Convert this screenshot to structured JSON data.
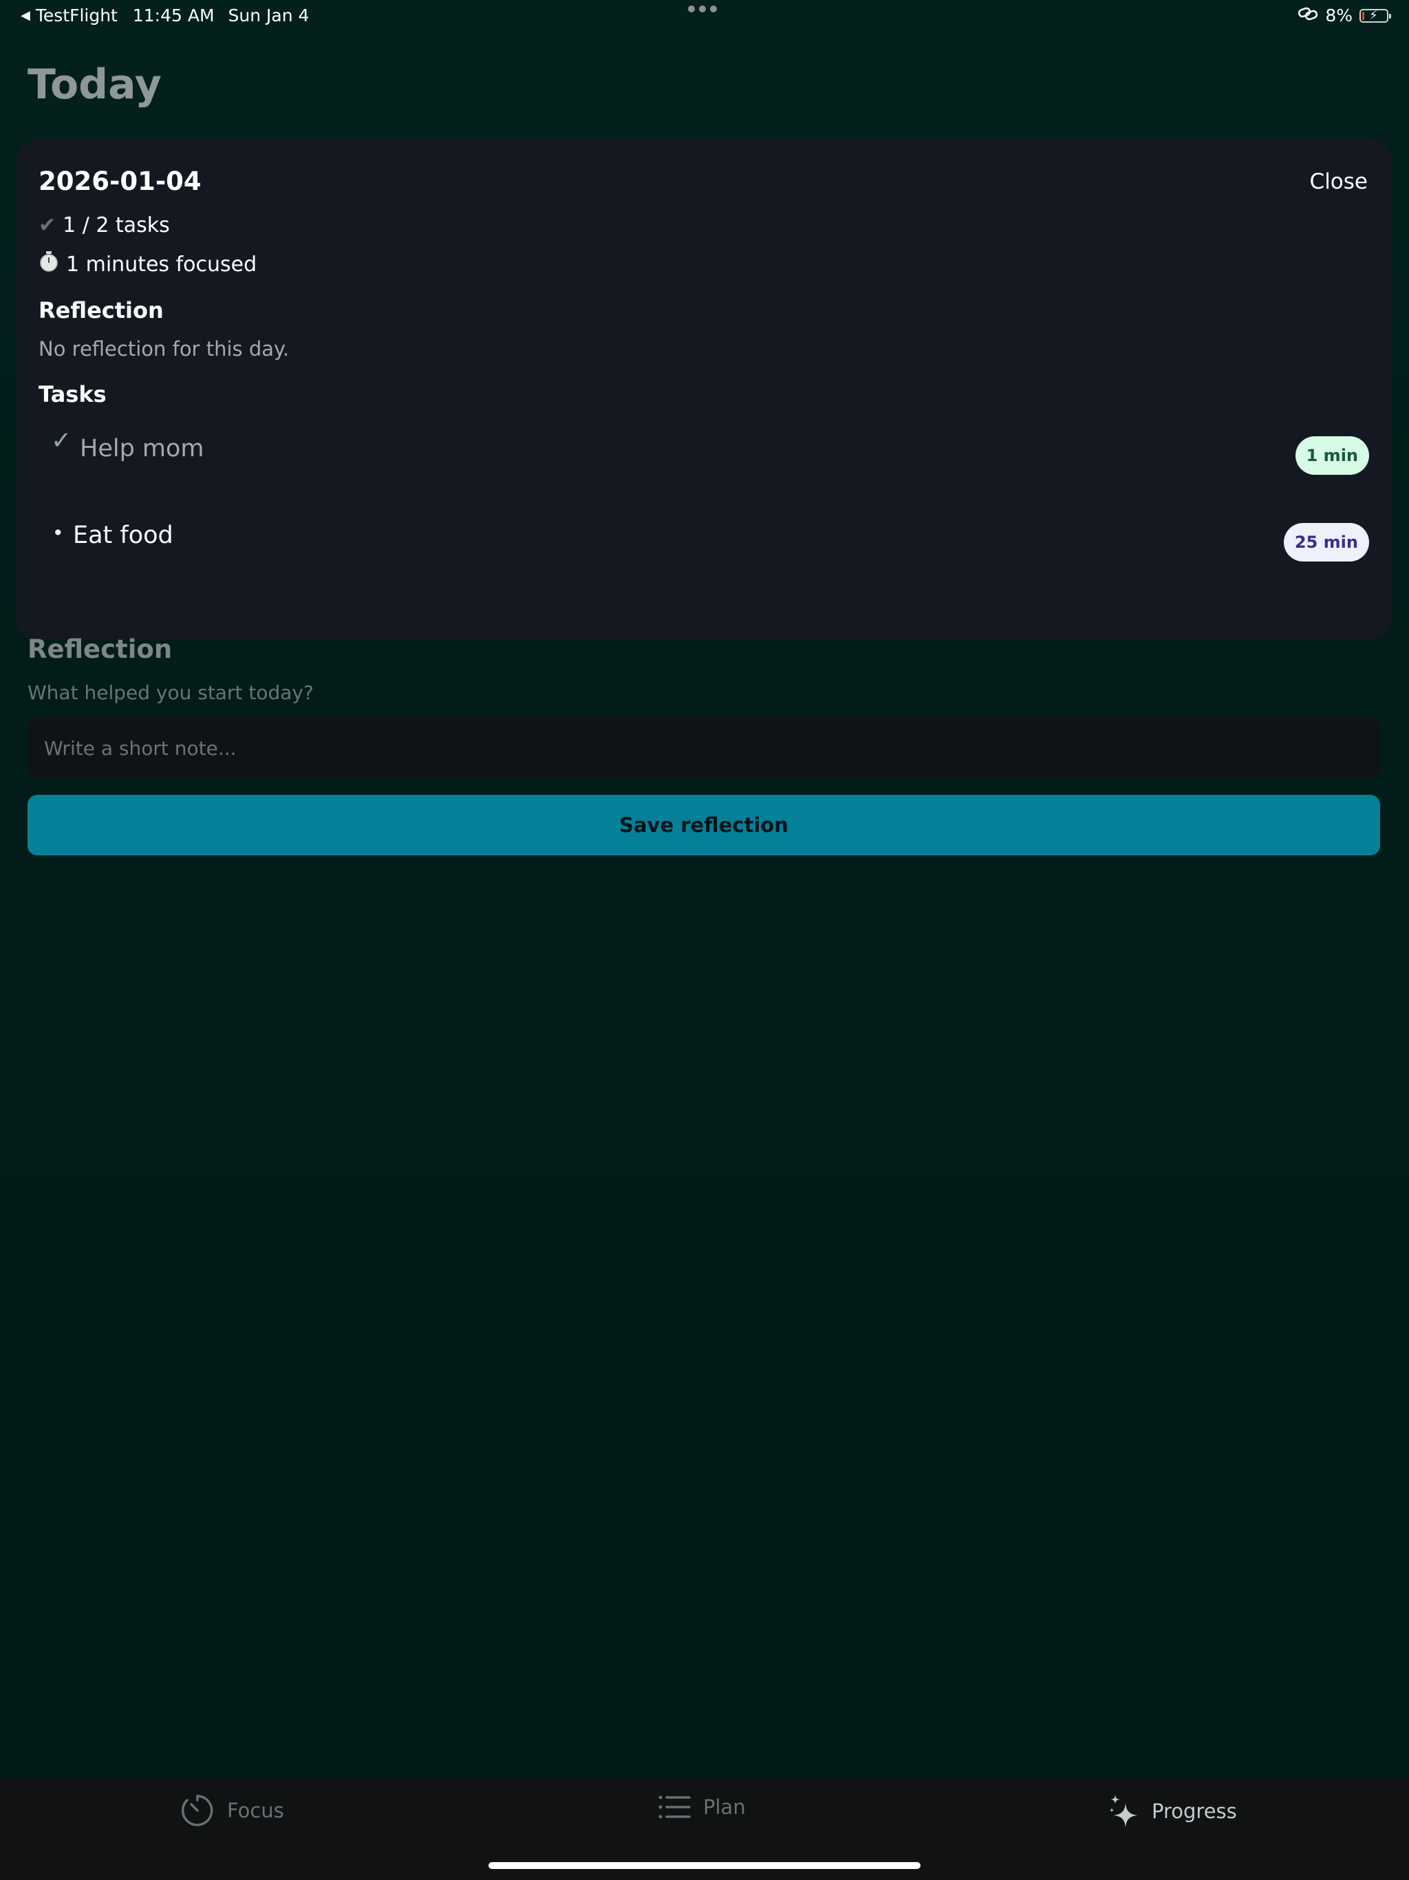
{
  "status_bar": {
    "back_app": "TestFlight",
    "time": "11:45 AM",
    "date": "Sun Jan 4",
    "battery": "8%"
  },
  "page": {
    "title": "Today"
  },
  "day_detail": {
    "date": "2026-01-04",
    "close_label": "Close",
    "tasks_summary": "1 / 2 tasks",
    "focus_summary": "1 minutes focused",
    "reflection_heading": "Reflection",
    "reflection_text": "No reflection for this day.",
    "tasks_heading": "Tasks",
    "tasks": [
      {
        "mark": "✓",
        "label": "Help mom",
        "duration": "1 min",
        "done": true
      },
      {
        "mark": "•",
        "label": "Eat food",
        "duration": "25 min",
        "done": false
      }
    ]
  },
  "reflection_form": {
    "title": "Reflection",
    "prompt": "What helped you start today?",
    "placeholder": "Write a short note...",
    "value": "",
    "save_label": "Save reflection"
  },
  "tabs": [
    {
      "label": "Focus",
      "icon": "timer-icon",
      "active": false
    },
    {
      "label": "Plan",
      "icon": "list-icon",
      "active": false
    },
    {
      "label": "Progress",
      "icon": "sparkles-icon",
      "active": true
    }
  ],
  "colors": {
    "accent": "#058099",
    "background": "#021c1a",
    "card": "#141821",
    "done_pill": "#d8fbe8",
    "pending_pill": "#eef0fb"
  }
}
